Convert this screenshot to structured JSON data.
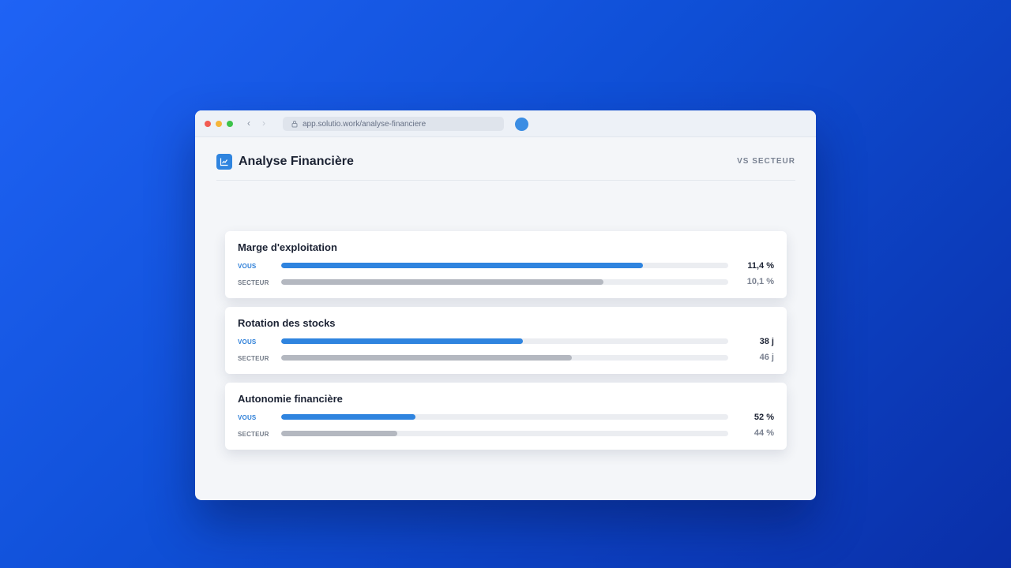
{
  "browser": {
    "url": "app.solutio.work/analyse-financiere",
    "back_icon": "‹",
    "forward_icon": "›"
  },
  "header": {
    "title": "Analyse Financière",
    "compare_link": "VS SECTEUR",
    "logo_icon": "line-chart-icon"
  },
  "colors": {
    "accent": "#2f84df",
    "sector_bar": "#b4b8c0",
    "track": "#ebedf1",
    "background_gradient": [
      "#1f63f5",
      "#0a2fa8"
    ]
  },
  "metrics": [
    {
      "title": "Marge d'exploitation",
      "you": {
        "label": "VOUS",
        "value": "11,4 %",
        "level": 0.81
      },
      "sector": {
        "label": "SECTEUR",
        "value": "10,1 %",
        "level": 0.72
      }
    },
    {
      "title": "Rotation des stocks",
      "you": {
        "label": "VOUS",
        "value": "38 j",
        "level": 0.54
      },
      "sector": {
        "label": "SECTEUR",
        "value": "46 j",
        "level": 0.65
      }
    },
    {
      "title": "Autonomie financière",
      "you": {
        "label": "VOUS",
        "value": "52 %",
        "level": 0.3
      },
      "sector": {
        "label": "SECTEUR",
        "value": "44 %",
        "level": 0.26
      }
    }
  ]
}
